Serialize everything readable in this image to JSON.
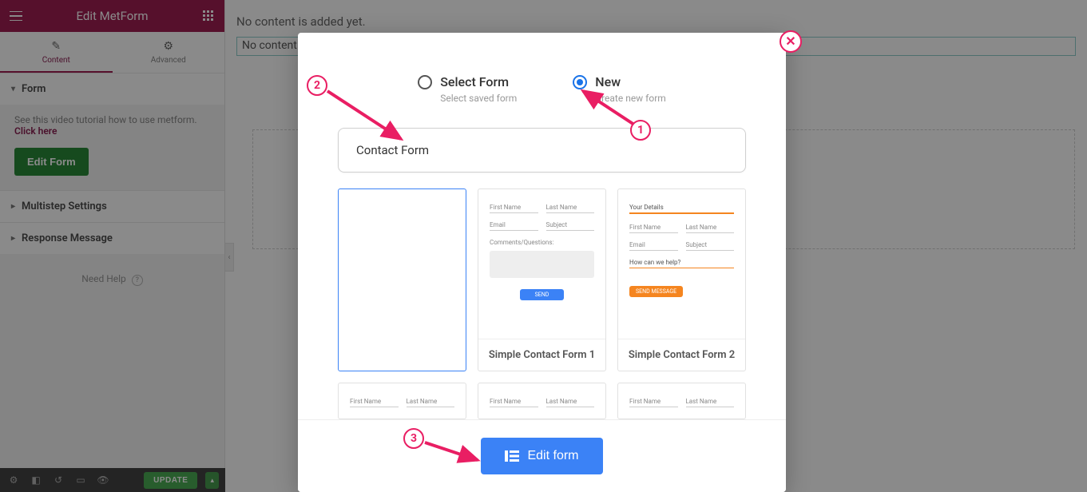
{
  "header": {
    "title": "Edit MetForm"
  },
  "tabs": {
    "content": "Content",
    "advanced": "Advanced"
  },
  "panel": {
    "form_label": "Form",
    "tutorial_text": "See this video tutorial how to use metform. ",
    "tutorial_link": "Click here",
    "edit_form_btn": "Edit Form",
    "multistep": "Multistep Settings",
    "response": "Response Message",
    "need_help": "Need Help"
  },
  "bottombar": {
    "update": "UPDATE"
  },
  "canvas": {
    "no_content_top": "No content is added yet.",
    "no_content_box": "No content"
  },
  "modal": {
    "select_label": "Select Form",
    "select_sub": "Select saved form",
    "new_label": "New",
    "new_sub": "Create new form",
    "form_name": "Contact Form",
    "edit_form": "Edit form"
  },
  "templates": {
    "t1_title": "",
    "t2_title": "Simple Contact Form 1",
    "t3_title": "Simple Contact Form 2",
    "fields": {
      "first_name": "First Name",
      "last_name": "Last Name",
      "email": "Email",
      "subject": "Subject",
      "comments": "Comments/Questions:",
      "your_details": "Your Details",
      "how_help": "How can we help?",
      "send": "SEND",
      "send_msg": "SEND MESSAGE"
    }
  },
  "markers": {
    "m1": "1",
    "m2": "2",
    "m3": "3"
  }
}
